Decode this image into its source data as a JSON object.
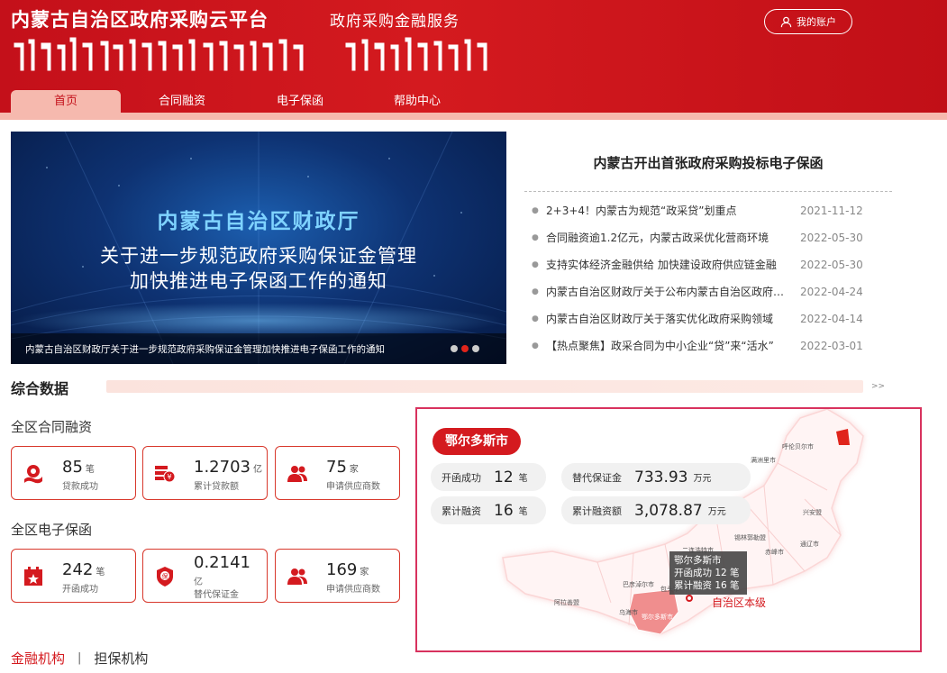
{
  "header": {
    "brand": "内蒙古自治区政府采购云平台",
    "subbrand": "政府采购金融服务",
    "account_label": "我的账户",
    "nav": [
      {
        "label": "首页",
        "active": true
      },
      {
        "label": "合同融资",
        "active": false
      },
      {
        "label": "电子保函",
        "active": false
      },
      {
        "label": "帮助中心",
        "active": false
      }
    ]
  },
  "banner": {
    "title": "内蒙古自治区财政厅",
    "line1": "关于进一步规范政府采购保证金管理",
    "line2": "加快推进电子保函工作的通知",
    "caption": "内蒙古自治区财政厅关于进一步规范政府采购保证金管理加快推进电子保函工作的通知"
  },
  "news": {
    "headline": "内蒙古开出首张政府采购投标电子保函",
    "items": [
      {
        "title": "2+3+4！内蒙古为规范“政采贷”划重点",
        "date": "2021-11-12"
      },
      {
        "title": "合同融资逾1.2亿元，内蒙古政采优化营商环境",
        "date": "2022-05-30"
      },
      {
        "title": "支持实体经济金融供给 加快建设政府供应链金融",
        "date": "2022-05-30"
      },
      {
        "title": "内蒙古自治区财政厅关于公布内蒙古自治区政府采购",
        "date": "2022-04-24"
      },
      {
        "title": "内蒙古自治区财政厅关于落实优化政府采购领域",
        "date": "2022-04-14"
      },
      {
        "title": "【热点聚焦】政采合同为中小企业“贷”来“活水”",
        "date": "2022-03-01"
      }
    ]
  },
  "summary": {
    "title": "综合数据",
    "more": ">>",
    "contract": {
      "title": "全区合同融资",
      "cards": [
        {
          "value": "85",
          "unit": "笔",
          "label": "贷款成功",
          "icon": "handshake-icon"
        },
        {
          "value": "1.2703",
          "unit": "亿",
          "label": "累计贷款额",
          "icon": "money-icon"
        },
        {
          "value": "75",
          "unit": "家",
          "label": "申请供应商数",
          "icon": "users-icon"
        }
      ]
    },
    "guarantee": {
      "title": "全区电子保函",
      "cards": [
        {
          "value": "242",
          "unit": "笔",
          "label": "开函成功",
          "icon": "calendar-icon"
        },
        {
          "value": "0.2141",
          "unit": "亿",
          "label": "替代保证金",
          "icon": "shield-icon"
        },
        {
          "value": "169",
          "unit": "家",
          "label": "申请供应商数",
          "icon": "users-icon"
        }
      ]
    }
  },
  "map": {
    "region": "鄂尔多斯市",
    "stats": [
      {
        "label": "开函成功",
        "value": "12",
        "unit": "笔"
      },
      {
        "label": "替代保证金",
        "value": "733.93",
        "unit": "万元"
      },
      {
        "label": "累计融资",
        "value": "16",
        "unit": "笔"
      },
      {
        "label": "累计融资额",
        "value": "3,078.87",
        "unit": "万元"
      }
    ],
    "city_labels": [
      "呼伦贝尔市",
      "满洲里市",
      "兴安盟",
      "通辽市",
      "赤峰市",
      "锡林郭勒盟",
      "二连浩特市",
      "巴彦淖尔市",
      "阿拉善盟",
      "乌海市",
      "鄂尔多斯市",
      "包头市"
    ],
    "tooltip": {
      "name": "鄂尔多斯市",
      "line1": "开函成功 12 笔",
      "line2": "累计融资 16 笔"
    },
    "legend_label": "自治区本级"
  },
  "tabs": [
    {
      "label": "金融机构",
      "active": true
    },
    {
      "label": "担保机构",
      "active": false
    }
  ]
}
